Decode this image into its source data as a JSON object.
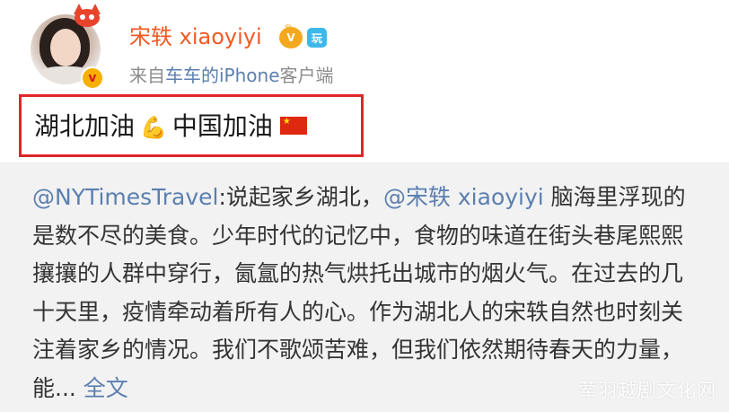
{
  "header": {
    "username": "宋轶 xiaoyiyi",
    "vip_badge": "V",
    "level_badge": "玩",
    "source_prefix": "来自",
    "source_device": "车车的iPhone",
    "source_suffix": "客户端",
    "verified_badge": "v"
  },
  "post": {
    "text_part1": "湖北加油",
    "emoji_arm": "💪",
    "text_part2": "中国加油",
    "flag_icon": "china-flag-icon"
  },
  "repost": {
    "mention1": "@NYTimesTravel",
    "text1": ":说起家乡湖北，",
    "mention2": "@宋轶 xiaoyiyi",
    "text2": " 脑海里浮现的是数不尽的美食。少年时代的记忆中，食物的味道在街头巷尾熙熙攘攘的人群中穿行，氤氲的热气烘托出城市的烟火气。在过去的几十天里，疫情牵动着所有人的心。作为湖北人的宋轶自然也时刻关注着家乡的情况。我们不歌颂苦难，但我们依然期待春天的力量，能...",
    "more_label": "全文"
  },
  "watermark": "荤羽越剧文化网",
  "colors": {
    "username": "#f15a24",
    "link": "#5b7fb0",
    "highlight_border": "#e0262c",
    "repost_bg": "#f2f2f2"
  }
}
